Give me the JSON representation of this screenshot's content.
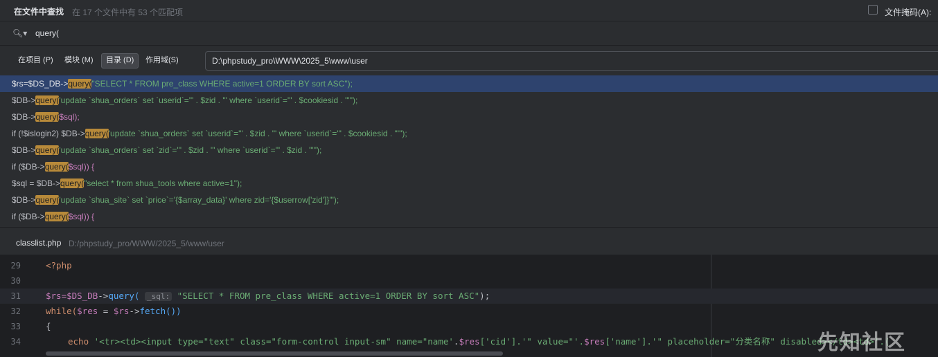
{
  "header": {
    "title": "在文件中查找",
    "subtitle": "在 17 个文件中有 53 个匹配项",
    "file_mask_label": "文件掩码(A):"
  },
  "search": {
    "query": "query("
  },
  "scope": {
    "tabs": [
      {
        "label": "在项目 (P)"
      },
      {
        "label": "模块 (M)"
      },
      {
        "label": "目录 (D)",
        "selected": true
      },
      {
        "label": "作用域(S)"
      }
    ],
    "directory": "D:\\phpstudy_pro\\WWW\\2025_5\\www\\user"
  },
  "results": [
    {
      "pre": "$rs=$DS_DB->",
      "match": "query(",
      "post": "\"SELECT * FROM pre_class WHERE active=1 ORDER BY sort ASC\");"
    },
    {
      "pre": "$DB->",
      "match": "query(",
      "post": "'update `shua_orders` set `userid`='\" . $zid . \"' where `userid`='\" . $cookiesid . \"'\");"
    },
    {
      "pre": "$DB->",
      "match": "query(",
      "post": "$sql);"
    },
    {
      "pre": "if (!$islogin2) $DB->",
      "match": "query(",
      "post": "'update `shua_orders` set `userid`='\" . $zid . \"' where `userid`='\" . $cookiesid . \"'\");"
    },
    {
      "pre": "$DB->",
      "match": "query(",
      "post": "'update `shua_orders` set `zid`='\" . $zid . \"' where `userid`='\" . $zid . \"'\");"
    },
    {
      "pre": "if ($DB->",
      "match": "query(",
      "post": "$sql)) {"
    },
    {
      "pre": "$sql = $DB->",
      "match": "query(",
      "post": "\"select * from shua_tools where active=1\");"
    },
    {
      "pre": "$DB->",
      "match": "query(",
      "post": "'update `shua_site` set `price`='{$array_data}' where zid='{$userrow['zid']}'\");"
    },
    {
      "pre": "if ($DB->",
      "match": "query(",
      "post": "$sql)) {"
    }
  ],
  "file": {
    "name": "classlist.php",
    "path": "D:/phpstudy_pro/WWW/2025_5/www/user"
  },
  "editor": {
    "lines": [
      {
        "num": "29",
        "text": "<?php"
      },
      {
        "num": "30",
        "text": ""
      },
      {
        "num": "31",
        "a": "$rs=",
        "b": "$DS_DB",
        "c": "->",
        "d": "query(",
        "hint": "_sql:",
        "e": "\"SELECT * FROM pre_class WHERE active=1 ORDER BY sort ASC\"",
        "f": ");"
      },
      {
        "num": "32",
        "a": "while(",
        "b": "$res",
        "c": " = ",
        "d": "$rs",
        "e": "->",
        "f": "fetch())"
      },
      {
        "num": "33",
        "text": "{"
      },
      {
        "num": "34",
        "a": "echo ",
        "b": "'<tr><td><input type=\"text\" class=\"form-control input-sm\" name=\"name'",
        "c": ".",
        "d": "$res",
        "e": "['cid'].'\" value=\"'.",
        "f": "$res",
        "g": "['name'].'\" placeholder=\"分类名称\" disabled></td><td>'.("
      }
    ]
  },
  "watermark": "先知社区"
}
